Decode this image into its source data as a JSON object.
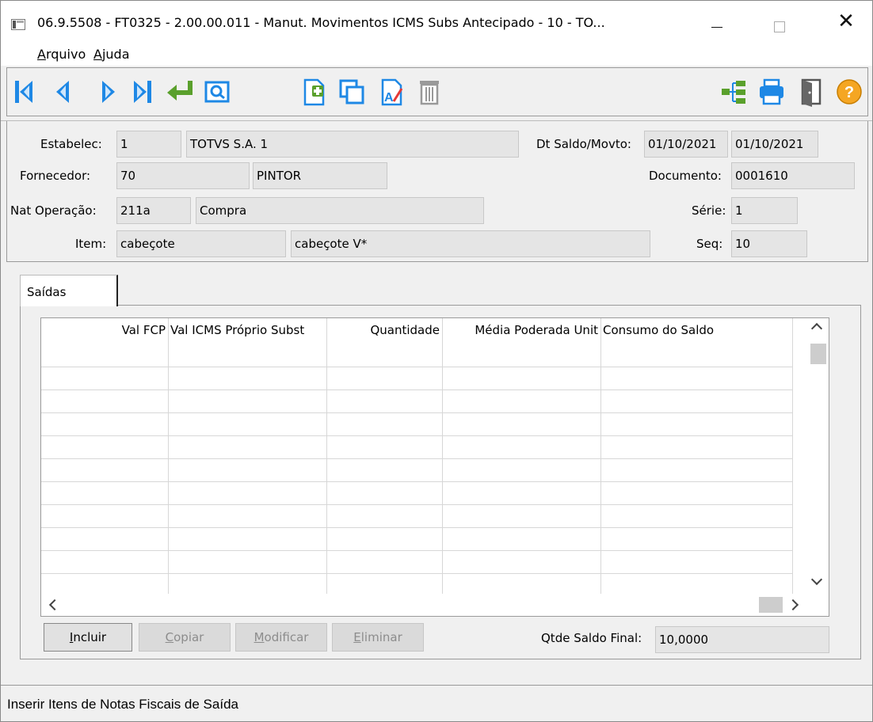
{
  "window": {
    "title": "06.9.5508 - FT0325 - 2.00.00.011 - Manut. Movimentos ICMS Subs Antecipado - 10 - TO...",
    "controls": {
      "minimize": "—",
      "maximize": "☐",
      "close": "✕"
    }
  },
  "menu": {
    "items": [
      {
        "underline": "A",
        "rest": "rquivo"
      },
      {
        "underline": "A",
        "rest": "juda"
      }
    ]
  },
  "toolbar": {
    "icons": [
      "first-icon",
      "prev-icon",
      "next-icon",
      "last-icon",
      "goto-icon",
      "search-icon",
      "add-icon",
      "copy-icon",
      "edit-icon",
      "delete-icon",
      "tree-icon",
      "print-icon",
      "exit-icon",
      "help-icon"
    ],
    "colors": {
      "nav_blue": "#1e88e5",
      "green": "#5aa02c",
      "help": "#f5a623"
    }
  },
  "header": {
    "estabelec_label": "Estabelec:",
    "estabelec_code": "1",
    "estabelec_name": "TOTVS S.A. 1",
    "fornecedor_label": "Fornecedor:",
    "fornecedor_code": "70",
    "fornecedor_name": "PINTOR",
    "nat_operacao_label": "Nat Operação:",
    "nat_operacao_code": "211a",
    "nat_operacao_desc": "Compra",
    "item_label": "Item:",
    "item_code": "cabeçote",
    "item_desc": "cabeçote V*",
    "dt_saldo_label": "Dt Saldo/Movto:",
    "dt_saldo": "01/10/2021",
    "dt_movto": "01/10/2021",
    "documento_label": "Documento:",
    "documento": "0001610",
    "serie_label": "Série:",
    "serie": "1",
    "seq_label": "Seq:",
    "seq": "10"
  },
  "tabs": [
    {
      "label": "Saídas"
    }
  ],
  "grid": {
    "columns": [
      "Val FCP",
      "Val ICMS Próprio Subst",
      "Quantidade",
      "Média Poderada Unit",
      "Consumo do Saldo"
    ],
    "rows": []
  },
  "buttons": {
    "incluir": {
      "underline": "I",
      "rest": "ncluir"
    },
    "copiar": {
      "underline": "C",
      "rest": "opiar"
    },
    "modificar": {
      "underline": "M",
      "rest": "odificar"
    },
    "eliminar": {
      "underline": "E",
      "rest": "liminar"
    }
  },
  "footer": {
    "qtde_saldo_final_label": "Qtde Saldo Final:",
    "qtde_saldo_final": "10,0000"
  },
  "status": {
    "text": "Inserir Itens de Notas Fiscais de Saída"
  }
}
